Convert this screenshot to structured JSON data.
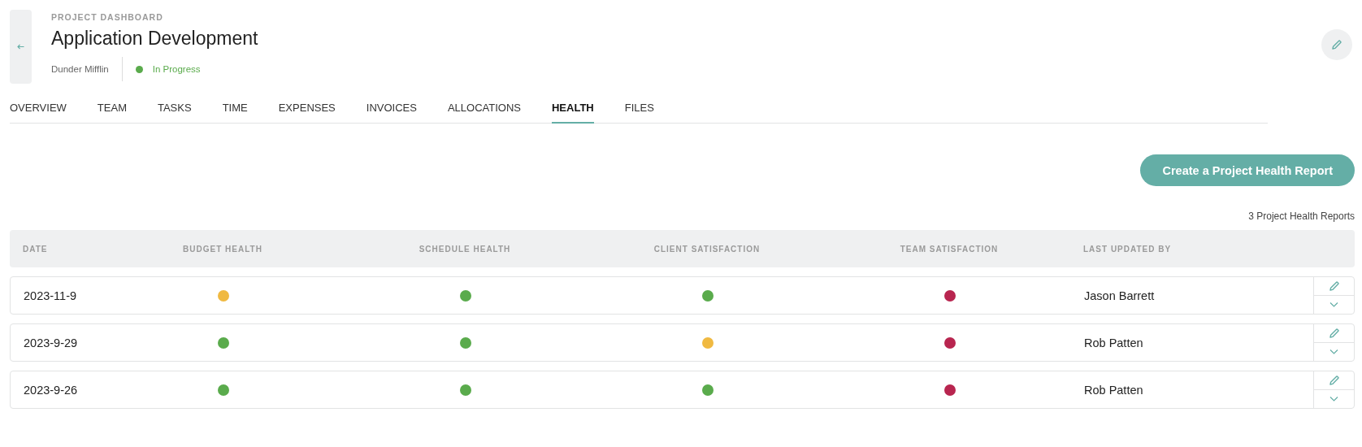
{
  "header": {
    "eyebrow": "PROJECT DASHBOARD",
    "title": "Application Development",
    "client": "Dunder Mifflin",
    "status": {
      "label": "In Progress",
      "color": "#5aab4c"
    }
  },
  "tabs": [
    {
      "label": "OVERVIEW",
      "selected": false
    },
    {
      "label": "TEAM",
      "selected": false
    },
    {
      "label": "TASKS",
      "selected": false
    },
    {
      "label": "TIME",
      "selected": false
    },
    {
      "label": "EXPENSES",
      "selected": false
    },
    {
      "label": "INVOICES",
      "selected": false
    },
    {
      "label": "ALLOCATIONS",
      "selected": false
    },
    {
      "label": "HEALTH",
      "selected": true
    },
    {
      "label": "FILES",
      "selected": false
    }
  ],
  "create_button": "Create a Project Health Report",
  "report_count": "3 Project Health Reports",
  "table": {
    "columns": [
      "DATE",
      "BUDGET HEALTH",
      "SCHEDULE HEALTH",
      "CLIENT SATISFACTION",
      "TEAM SATISFACTION",
      "LAST UPDATED BY"
    ],
    "rows": [
      {
        "date": "2023-11-9",
        "health": [
          {
            "color": "#f0b941"
          },
          {
            "color": "#5aab4c"
          },
          {
            "color": "#5aab4c"
          },
          {
            "color": "#b8254f"
          }
        ],
        "updated_by": "Jason Barrett"
      },
      {
        "date": "2023-9-29",
        "health": [
          {
            "color": "#5aab4c"
          },
          {
            "color": "#5aab4c"
          },
          {
            "color": "#f0b941"
          },
          {
            "color": "#b8254f"
          }
        ],
        "updated_by": "Rob Patten"
      },
      {
        "date": "2023-9-26",
        "health": [
          {
            "color": "#5aab4c"
          },
          {
            "color": "#5aab4c"
          },
          {
            "color": "#5aab4c"
          },
          {
            "color": "#b8254f"
          }
        ],
        "updated_by": "Rob Patten"
      }
    ]
  }
}
